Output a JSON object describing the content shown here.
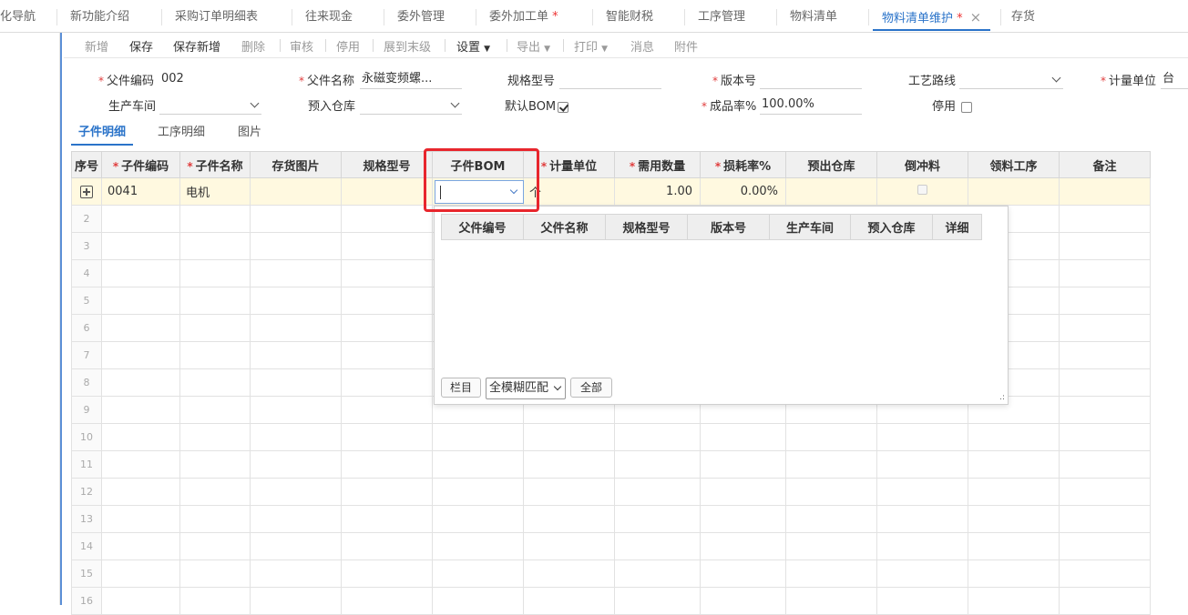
{
  "tabs": [
    {
      "label": "化导航",
      "active": false
    },
    {
      "label": "新功能介绍",
      "active": false
    },
    {
      "label": "采购订单明细表",
      "active": false
    },
    {
      "label": "往来现金",
      "active": false
    },
    {
      "label": "委外管理",
      "active": false
    },
    {
      "label": "委外加工单",
      "active": false,
      "dirty": "*"
    },
    {
      "label": "智能财税",
      "active": false
    },
    {
      "label": "工序管理",
      "active": false
    },
    {
      "label": "物料清单",
      "active": false
    },
    {
      "label": "物料清单维护",
      "active": true,
      "dirty": "*",
      "close": "×"
    },
    {
      "label": "存货",
      "active": false
    }
  ],
  "toolbar": {
    "new": "新增",
    "save": "保存",
    "save_new": "保存新增",
    "delete": "删除",
    "audit": "审核",
    "disable": "停用",
    "expand": "展到末级",
    "settings": "设置",
    "export": "导出",
    "print": "打印",
    "message": "消息",
    "attachment": "附件"
  },
  "form": {
    "parent_code_label": "父件编码",
    "parent_code": "002",
    "parent_name_label": "父件名称",
    "parent_name": "永磁变频螺...",
    "spec_label": "规格型号",
    "spec": "",
    "version_label": "版本号",
    "version": "",
    "route_label": "工艺路线",
    "route": "",
    "uom_label": "计量单位",
    "uom": "台",
    "workshop_label": "生产车间",
    "workshop": "",
    "warehouse_label": "预入仓库",
    "warehouse": "",
    "default_bom_label": "默认BOM",
    "default_bom_checked": true,
    "yield_label": "成品率%",
    "yield": "100.00%",
    "disabled_label": "停用",
    "disabled_checked": false,
    "required_mark": "*"
  },
  "subtabs": {
    "detail": "子件明细",
    "process": "工序明细",
    "image": "图片"
  },
  "grid": {
    "headers": [
      "序号",
      "子件编码",
      "子件名称",
      "存货图片",
      "规格型号",
      "子件BOM",
      "计量单位",
      "需用数量",
      "损耗率%",
      "预出仓库",
      "倒冲料",
      "领料工序",
      "备注"
    ],
    "row1": {
      "code": "0041",
      "name": "电机",
      "qty": "1.00",
      "loss": "0.00%",
      "uom_partial": "个"
    },
    "row_numbers": [
      "2",
      "3",
      "4",
      "5",
      "6",
      "7",
      "8",
      "9",
      "10",
      "11",
      "12",
      "13",
      "14",
      "15",
      "16"
    ]
  },
  "popup": {
    "headers": [
      "父件编号",
      "父件名称",
      "规格型号",
      "版本号",
      "生产车间",
      "预入仓库",
      "详细"
    ],
    "columns_btn": "栏目",
    "match_mode": "全模糊匹配",
    "all_btn": "全部"
  }
}
